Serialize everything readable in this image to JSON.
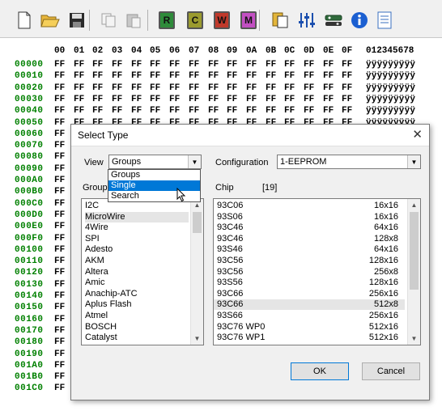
{
  "toolbar": {
    "buttons": [
      {
        "name": "new-file-icon"
      },
      {
        "name": "open-folder-icon"
      },
      {
        "name": "save-icon"
      },
      {
        "name": "copy-icon"
      },
      {
        "name": "paste-icon"
      },
      {
        "name": "read-chip-icon",
        "letter": "R",
        "color": "#2e8b3a"
      },
      {
        "name": "check-chip-icon",
        "letter": "C",
        "color": "#9b9b2e"
      },
      {
        "name": "write-chip-icon",
        "letter": "W",
        "color": "#c0392b"
      },
      {
        "name": "erase-chip-icon",
        "letter": "M",
        "color": "#c24fc2"
      },
      {
        "name": "chip-select-icon"
      },
      {
        "name": "settings-sliders-icon"
      },
      {
        "name": "hardware-icon"
      },
      {
        "name": "info-icon"
      },
      {
        "name": "document-icon"
      }
    ]
  },
  "hex": {
    "columns": [
      "00",
      "01",
      "02",
      "03",
      "04",
      "05",
      "06",
      "07",
      "08",
      "09",
      "0A",
      "0B",
      "0C",
      "0D",
      "0E",
      "0F"
    ],
    "ascii_header": "012345678",
    "rows": [
      {
        "addr": "00000",
        "ascii": "ÿÿÿÿÿÿÿÿÿ"
      },
      {
        "addr": "00010",
        "ascii": "ÿÿÿÿÿÿÿÿÿ"
      },
      {
        "addr": "00020",
        "ascii": "ÿÿÿÿÿÿÿÿÿ"
      },
      {
        "addr": "00030",
        "ascii": "ÿÿÿÿÿÿÿÿÿ"
      },
      {
        "addr": "00040",
        "ascii": "ÿÿÿÿÿÿÿÿÿ"
      },
      {
        "addr": "00050",
        "ascii": "ÿÿÿÿÿÿÿÿÿ"
      },
      {
        "addr": "00060",
        "ascii": ""
      },
      {
        "addr": "00070",
        "ascii": ""
      },
      {
        "addr": "00080",
        "ascii": ""
      },
      {
        "addr": "00090",
        "ascii": ""
      },
      {
        "addr": "000A0",
        "ascii": ""
      },
      {
        "addr": "000B0",
        "ascii": ""
      },
      {
        "addr": "000C0",
        "ascii": ""
      },
      {
        "addr": "000D0",
        "ascii": ""
      },
      {
        "addr": "000E0",
        "ascii": ""
      },
      {
        "addr": "000F0",
        "ascii": ""
      },
      {
        "addr": "00100",
        "ascii": ""
      },
      {
        "addr": "00110",
        "ascii": ""
      },
      {
        "addr": "00120",
        "ascii": ""
      },
      {
        "addr": "00130",
        "ascii": ""
      },
      {
        "addr": "00140",
        "ascii": ""
      },
      {
        "addr": "00150",
        "ascii": ""
      },
      {
        "addr": "00160",
        "ascii": ""
      },
      {
        "addr": "00170",
        "ascii": ""
      },
      {
        "addr": "00180",
        "ascii": ""
      },
      {
        "addr": "00190",
        "ascii": ""
      },
      {
        "addr": "001A0",
        "ascii": ""
      },
      {
        "addr": "001B0",
        "ascii": ""
      },
      {
        "addr": "001C0",
        "ascii": ""
      }
    ],
    "byte_value": "FF"
  },
  "dialog": {
    "title": "Select Type",
    "close": "✕",
    "view_label": "View",
    "view_value": "Groups",
    "view_options": [
      "Groups",
      "Single",
      "Search"
    ],
    "view_selected_index": 1,
    "configuration_label": "Configuration",
    "configuration_value": "1-EEPROM",
    "group_label": "Group",
    "chip_label": "Chip",
    "chip_count": "[19]",
    "groups": [
      "I2C",
      "MicroWire",
      "4Wire",
      "SPI",
      "Adesto",
      "AKM",
      "Altera",
      "Amic",
      "Anachip-ATC",
      "Aplus Flash",
      "Atmel",
      "BOSCH",
      "Catalyst"
    ],
    "group_highlight_index": 1,
    "chips": [
      {
        "name": "93C06",
        "size": "16x16"
      },
      {
        "name": "93S06",
        "size": "16x16"
      },
      {
        "name": "93C46",
        "size": "64x16"
      },
      {
        "name": "93C46",
        "size": "128x8"
      },
      {
        "name": "93S46",
        "size": "64x16"
      },
      {
        "name": "93C56",
        "size": "128x16"
      },
      {
        "name": "93C56",
        "size": "256x8"
      },
      {
        "name": "93S56",
        "size": "128x16"
      },
      {
        "name": "93C66",
        "size": "256x16"
      },
      {
        "name": "93C66",
        "size": "512x8"
      },
      {
        "name": "93S66",
        "size": "256x16"
      },
      {
        "name": "93C76 WP0",
        "size": "512x16"
      },
      {
        "name": "93C76 WP1",
        "size": "512x16"
      }
    ],
    "chip_highlight_index": 9,
    "ok_label": "OK",
    "cancel_label": "Cancel"
  }
}
